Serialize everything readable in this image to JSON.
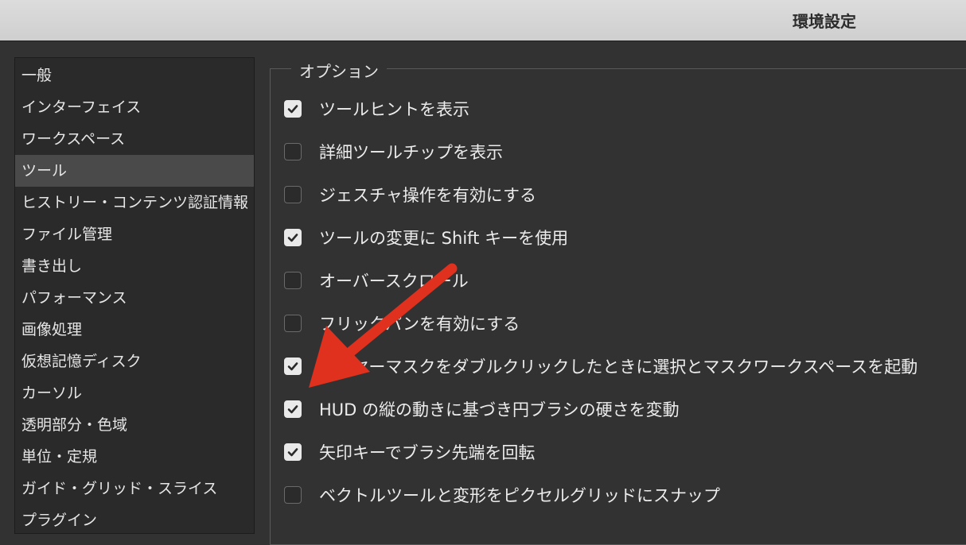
{
  "window": {
    "title": "環境設定"
  },
  "sidebar": {
    "items": [
      {
        "label": "一般",
        "selected": false
      },
      {
        "label": "インターフェイス",
        "selected": false
      },
      {
        "label": "ワークスペース",
        "selected": false
      },
      {
        "label": "ツール",
        "selected": true
      },
      {
        "label": "ヒストリー・コンテンツ認証情報",
        "selected": false
      },
      {
        "label": "ファイル管理",
        "selected": false
      },
      {
        "label": "書き出し",
        "selected": false
      },
      {
        "label": "パフォーマンス",
        "selected": false
      },
      {
        "label": "画像処理",
        "selected": false
      },
      {
        "label": "仮想記憶ディスク",
        "selected": false
      },
      {
        "label": "カーソル",
        "selected": false
      },
      {
        "label": "透明部分・色域",
        "selected": false
      },
      {
        "label": "単位・定規",
        "selected": false
      },
      {
        "label": "ガイド・グリッド・スライス",
        "selected": false
      },
      {
        "label": "プラグイン",
        "selected": false
      }
    ]
  },
  "options": {
    "group_label": "オプション",
    "items": [
      {
        "label": "ツールヒントを表示",
        "checked": true
      },
      {
        "label": "詳細ツールチップを表示",
        "checked": false
      },
      {
        "label": "ジェスチャ操作を有効にする",
        "checked": false
      },
      {
        "label": "ツールの変更に Shift キーを使用",
        "checked": true
      },
      {
        "label": "オーバースクロール",
        "checked": false
      },
      {
        "label": "フリックパンを有効にする",
        "checked": false
      },
      {
        "label": "レイヤーマスクをダブルクリックしたときに選択とマスクワークスペースを起動",
        "checked": true
      },
      {
        "label": "HUD の縦の動きに基づき円ブラシの硬さを変動",
        "checked": true
      },
      {
        "label": "矢印キーでブラシ先端を回転",
        "checked": true
      },
      {
        "label": "ベクトルツールと変形をピクセルグリッドにスナップ",
        "checked": false
      }
    ]
  },
  "colors": {
    "annotation_arrow": "#e0301e",
    "selected_item_bg": "#4a4a4a",
    "checkbox_checked": "#e9e9e9"
  }
}
